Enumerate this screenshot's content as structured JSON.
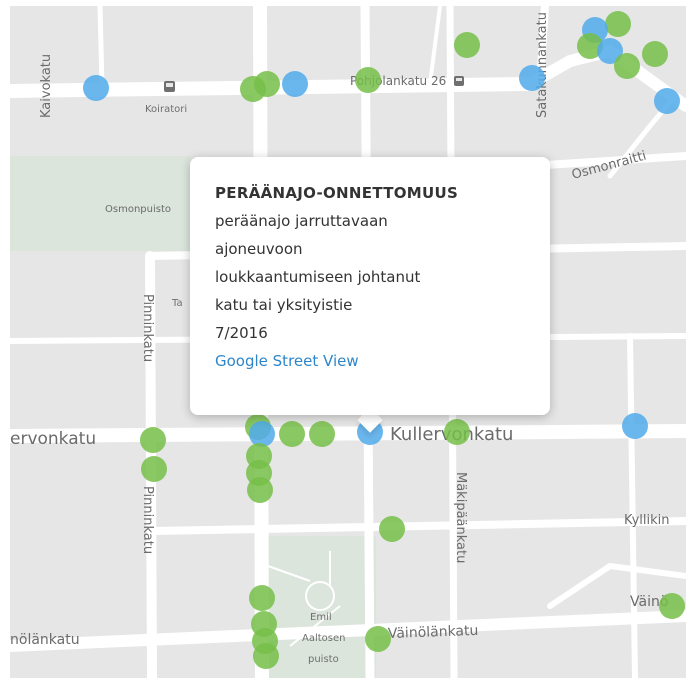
{
  "popup": {
    "title": "PERÄÄNAJO-ONNETTOMUUS",
    "lines": [
      "peräänajo jarruttavaan",
      "ajoneuvoon",
      "loukkaantumiseen johtanut",
      "katu tai yksityistie",
      "7/2016"
    ],
    "link": "Google Street View",
    "link_color": "#2e86c9"
  },
  "streets": {
    "kaivokatu": "Kaivokatu",
    "pohjolankatu": "Pohjolankatu 26",
    "satakunnankatu": "Satakunnankatu",
    "osmonraitti": "Osmonraitti",
    "osmonpuisto": "Osmonpuisto",
    "pinninkatu_n": "Pinninkatu",
    "pinninkatu_s": "Pinninkatu",
    "kullervonkatu_w": "ervonkatu",
    "kullervonkatu_e": "Kullervonkatu",
    "makipaankatu": "Mäkipäänkatu",
    "kyllikinkatu": "Kyllikin",
    "vainolankatu_w": "nölänkatu",
    "vainolankatu_c": "Väinölänkatu",
    "vainolankatu_e": "Väinö"
  },
  "pois": {
    "koiratori": "Koiratori",
    "tagore": "Ta",
    "emil_1": "Emil",
    "emil_2": "Aaltosen",
    "emil_3": "puisto"
  },
  "colors": {
    "green_marker": "#76be48",
    "blue_marker": "#50aaeb",
    "map_background": "#e6e6e6"
  }
}
